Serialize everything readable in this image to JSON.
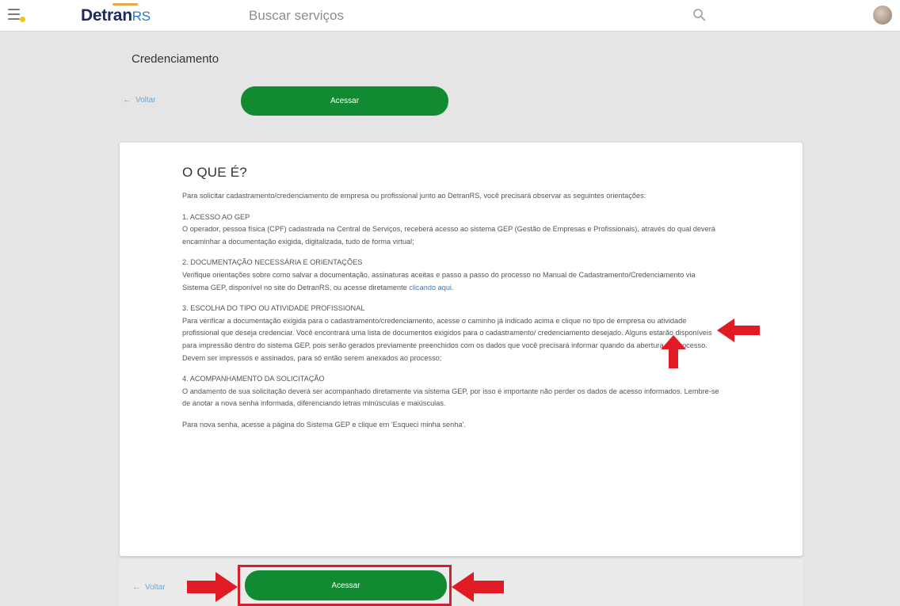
{
  "header": {
    "logo_main": "Detran",
    "logo_suffix": "RS",
    "search_placeholder": "Buscar serviços"
  },
  "page": {
    "title": "Credenciamento",
    "back_label": "Voltar",
    "access_label": "Acessar"
  },
  "article": {
    "heading": "O QUE É?",
    "intro": "Para solicitar cadastramento/credenciamento de empresa ou profissional junto ao DetranRS, você precisará observar as seguintes orientações:",
    "s1_title": "1. ACESSO AO GEP",
    "s1_body": "O operador, pessoa física (CPF) cadastrada na Central de Serviços, receberá acesso ao sistema GEP (Gestão de Empresas e Profissionais), através do qual deverá encaminhar a documentação exigida, digitalizada, tudo de forma virtual;",
    "s2_title": "2. DOCUMENTAÇÃO NECESSÁRIA E ORIENTAÇÕES",
    "s2_body": "Verifique orientações sobre como salvar a documentação, assinaturas aceitas e passo a passo do processo no Manual de Cadastramento/Credenciamento via Sistema GEP, disponível no site do DetranRS, ou acesse diretamente",
    "s2_link": "clicando aqui",
    "s3_title": "3. ESCOLHA DO TIPO OU ATIVIDADE PROFISSIONAL",
    "s3_body": "Para verificar a documentação exigida para o cadastramento/credenciamento, acesse o caminho já indicado acima e clique no tipo de empresa ou atividade profissional que deseja credenciar. Você encontrará uma lista de documentos exigidos para o cadastramento/ credenciamento desejado. Alguns estarão disponíveis para impressão dentro do sistema GEP, pois serão gerados previamente preenchidos com os dados que você precisará informar quando da abertura do processo. Devem ser impressos e assinados, para só então serem anexados ao processo;",
    "s4_title": "4. ACOMPANHAMENTO DA SOLICITAÇÃO",
    "s4_body": "O andamento de sua solicitação deverá ser acompanhado diretamente via sistema GEP, por isso é importante não perder os dados de acesso informados. Lembre-se de anotar a nova senha informada, diferenciando letras minúsculas e maiúsculas.",
    "footer_note": "Para nova senha, acesse a página do Sistema GEP e clique em 'Esqueci minha senha'."
  },
  "colors": {
    "primary_green": "#128a31",
    "annotation_red": "#d4202a",
    "link_blue": "#2e7fd8"
  }
}
